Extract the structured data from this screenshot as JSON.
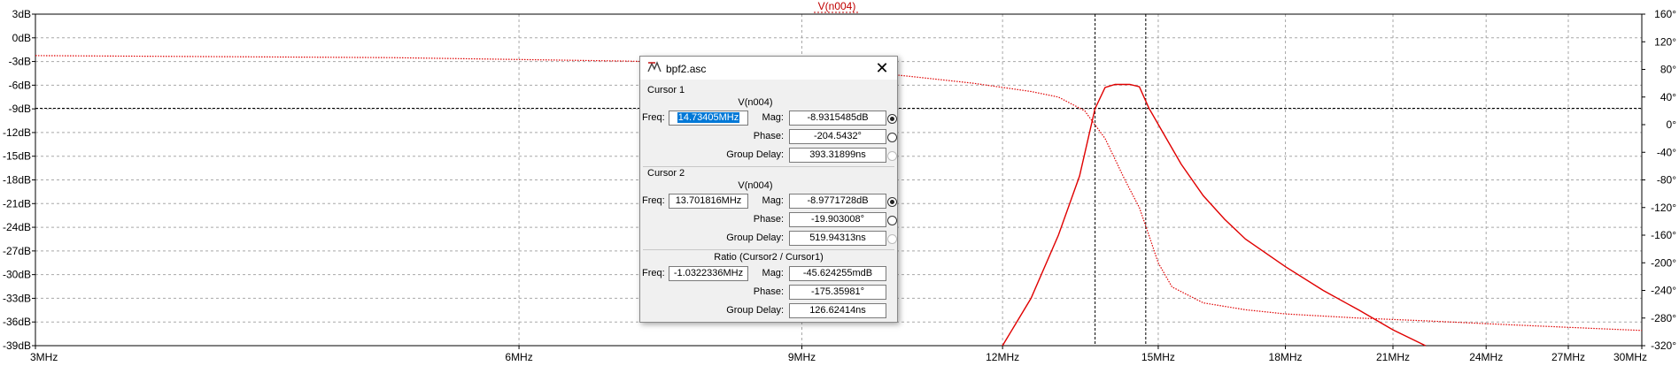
{
  "chart_data": {
    "type": "line",
    "title": "V(n004)",
    "x_axis": {
      "scale": "log",
      "range_mhz": [
        3,
        30
      ],
      "ticks": [
        {
          "v": 3,
          "label": "3MHz"
        },
        {
          "v": 6,
          "label": "6MHz"
        },
        {
          "v": 9,
          "label": "9MHz"
        },
        {
          "v": 12,
          "label": "12MHz"
        },
        {
          "v": 15,
          "label": "15MHz"
        },
        {
          "v": 18,
          "label": "18MHz"
        },
        {
          "v": 21,
          "label": "21MHz"
        },
        {
          "v": 24,
          "label": "24MHz"
        },
        {
          "v": 27,
          "label": "27MHz"
        },
        {
          "v": 30,
          "label": "30MHz"
        }
      ]
    },
    "y_left": {
      "unit": "dB",
      "range": [
        -39,
        3
      ],
      "ticks": [
        {
          "v": 3,
          "label": "3dB"
        },
        {
          "v": 0,
          "label": "0dB"
        },
        {
          "v": -3,
          "label": "-3dB"
        },
        {
          "v": -6,
          "label": "-6dB"
        },
        {
          "v": -9,
          "label": "-9dB"
        },
        {
          "v": -12,
          "label": "-12dB"
        },
        {
          "v": -15,
          "label": "-15dB"
        },
        {
          "v": -18,
          "label": "-18dB"
        },
        {
          "v": -21,
          "label": "-21dB"
        },
        {
          "v": -24,
          "label": "-24dB"
        },
        {
          "v": -27,
          "label": "-27dB"
        },
        {
          "v": -30,
          "label": "-30dB"
        },
        {
          "v": -33,
          "label": "-33dB"
        },
        {
          "v": -36,
          "label": "-36dB"
        },
        {
          "v": -39,
          "label": "-39dB"
        }
      ]
    },
    "y_right": {
      "unit": "°",
      "range": [
        -320,
        160
      ],
      "ticks": [
        {
          "v": 160,
          "label": "160°"
        },
        {
          "v": 120,
          "label": "120°"
        },
        {
          "v": 80,
          "label": "80°"
        },
        {
          "v": 40,
          "label": "40°"
        },
        {
          "v": 0,
          "label": "0°"
        },
        {
          "v": -40,
          "label": "-40°"
        },
        {
          "v": -80,
          "label": "-80°"
        },
        {
          "v": -120,
          "label": "-120°"
        },
        {
          "v": -160,
          "label": "-160°"
        },
        {
          "v": -200,
          "label": "-200°"
        },
        {
          "v": -240,
          "label": "-240°"
        },
        {
          "v": -280,
          "label": "-280°"
        },
        {
          "v": -320,
          "label": "-320°"
        }
      ]
    },
    "grid": true,
    "series": [
      {
        "name": "V(n004)",
        "quantity": "magnitude",
        "axis": "left",
        "color": "#e00000",
        "style": "solid",
        "points": [
          [
            12.0,
            -39.5
          ],
          [
            12.5,
            -33.0
          ],
          [
            13.0,
            -25.0
          ],
          [
            13.4,
            -17.5
          ],
          [
            13.7,
            -9.0
          ],
          [
            13.9,
            -6.3
          ],
          [
            14.1,
            -5.9
          ],
          [
            14.4,
            -5.9
          ],
          [
            14.6,
            -6.2
          ],
          [
            14.8,
            -8.9
          ],
          [
            15.1,
            -12.0
          ],
          [
            15.5,
            -16.0
          ],
          [
            16.0,
            -20.0
          ],
          [
            16.5,
            -23.0
          ],
          [
            17.0,
            -25.5
          ],
          [
            18.0,
            -29.0
          ],
          [
            19.0,
            -32.0
          ],
          [
            20.0,
            -34.5
          ],
          [
            21.0,
            -37.0
          ],
          [
            22.0,
            -39.0
          ]
        ]
      },
      {
        "name": "V(n004)",
        "quantity": "phase",
        "axis": "right",
        "color": "#e00000",
        "style": "dotted",
        "points": [
          [
            3.0,
            100
          ],
          [
            5.0,
            97
          ],
          [
            7.0,
            92
          ],
          [
            8.5,
            87
          ],
          [
            9.5,
            80
          ],
          [
            10.5,
            70
          ],
          [
            11.5,
            60
          ],
          [
            12.5,
            48
          ],
          [
            13.0,
            40
          ],
          [
            13.5,
            20
          ],
          [
            13.9,
            -20
          ],
          [
            14.3,
            -80
          ],
          [
            14.6,
            -120
          ],
          [
            14.8,
            -160
          ],
          [
            15.0,
            -200
          ],
          [
            15.3,
            -235
          ],
          [
            16.0,
            -258
          ],
          [
            17.0,
            -268
          ],
          [
            18.0,
            -274
          ],
          [
            20.0,
            -280
          ],
          [
            22.0,
            -284
          ],
          [
            25.0,
            -290
          ],
          [
            28.0,
            -295
          ],
          [
            30.0,
            -298
          ]
        ]
      }
    ],
    "cursors": [
      {
        "id": 1,
        "freq_mhz": 14.73405,
        "y_db": -8.9315485
      },
      {
        "id": 2,
        "freq_mhz": 13.701816,
        "y_db": -8.9771728
      }
    ]
  },
  "dialog": {
    "title": "bpf2.asc",
    "cursor1": {
      "label": "Cursor 1",
      "trace": "V(n004)",
      "freq_label": "Freq:",
      "freq": "14.73405MHz",
      "mag_label": "Mag:",
      "mag": "-8.9315485dB",
      "phase_label": "Phase:",
      "phase": "-204.5432°",
      "gd_label": "Group Delay:",
      "group_delay": "393.31899ns"
    },
    "cursor2": {
      "label": "Cursor 2",
      "trace": "V(n004)",
      "freq_label": "Freq:",
      "freq": "13.701816MHz",
      "mag_label": "Mag:",
      "mag": "-8.9771728dB",
      "phase_label": "Phase:",
      "phase": "-19.903008°",
      "gd_label": "Group Delay:",
      "group_delay": "519.94313ns"
    },
    "ratio": {
      "label": "Ratio (Cursor2 / Cursor1)",
      "freq_label": "Freq:",
      "freq": "-1.0322336MHz",
      "mag_label": "Mag:",
      "mag": "-45.624255mdB",
      "phase_label": "Phase:",
      "phase": "-175.35981°",
      "gd_label": "Group Delay:",
      "group_delay": "126.62414ns"
    },
    "icons": {
      "app": "ltspice-icon",
      "close": "close-icon"
    }
  }
}
